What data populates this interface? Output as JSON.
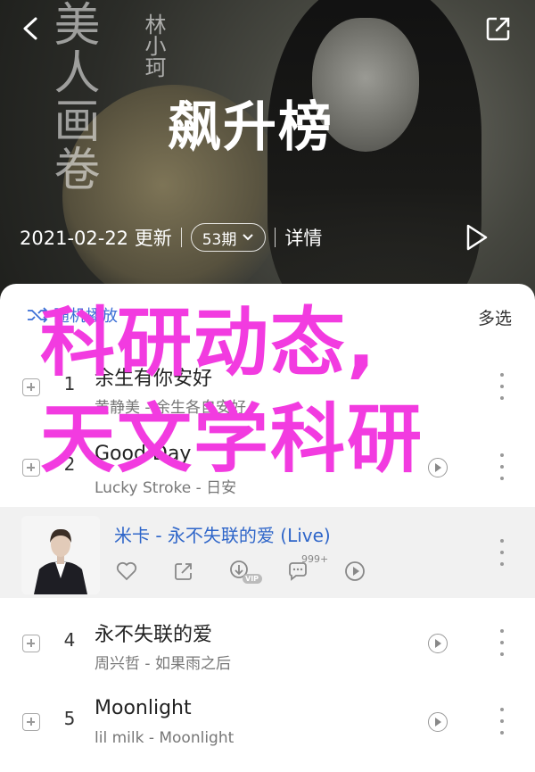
{
  "header": {
    "book_title": "美人画卷",
    "book_author": "林小珂",
    "title": "飙升榜",
    "date": "2021-02-22 更新",
    "count": "53期",
    "detail": "详情"
  },
  "controls": {
    "shuffle": "随机播放",
    "multi_select": "多选"
  },
  "songs": [
    {
      "num": "1",
      "title": "余生有你安好",
      "artist": "黄静美 - 余生各自安好"
    },
    {
      "num": "2",
      "title": "Good Day",
      "artist": "Lucky Stroke - 日安"
    },
    {
      "num": "",
      "title": "米卡 - 永不失联的爱 (Live)",
      "artist": ""
    },
    {
      "num": "4",
      "title": "永不失联的爱",
      "artist": "周兴哲 - 如果雨之后"
    },
    {
      "num": "5",
      "title": "Moonlight",
      "artist": "lil milk - Moonlight"
    }
  ],
  "active_song": {
    "comment_count": "999+",
    "vip_label": "VIP"
  },
  "overlay": {
    "line1": "科研动态,",
    "line2": "天文学科研"
  },
  "colors": {
    "accent": "#3b6fd6",
    "overlay": "#f23be0"
  }
}
